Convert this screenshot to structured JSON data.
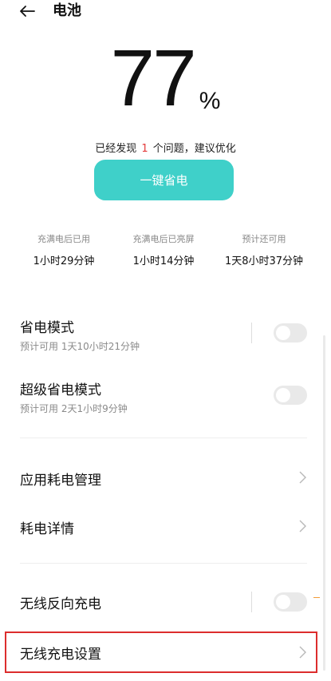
{
  "header": {
    "title": "电池",
    "back_icon": "arrow-left-icon"
  },
  "battery": {
    "percent": "77",
    "percent_sign": "%",
    "issue_prefix": "已经发现",
    "issue_count": "1",
    "issue_suffix": "个问题，建议优化",
    "optimize_label": "一键省电"
  },
  "stats": [
    {
      "label": "充满电后已用",
      "value": "1小时29分钟"
    },
    {
      "label": "充满电后已亮屏",
      "value": "1小时14分钟"
    },
    {
      "label": "预计还可用",
      "value": "1天8小时37分钟"
    }
  ],
  "rows": {
    "power_saving": {
      "title": "省电模式",
      "subtitle": "预计可用 1天10小时21分钟",
      "enabled": false
    },
    "super_power_saving": {
      "title": "超级省电模式",
      "subtitle": "预计可用 2天1小时9分钟",
      "enabled": false
    },
    "app_power_management": {
      "title": "应用耗电管理"
    },
    "power_details": {
      "title": "耗电详情"
    },
    "wireless_reverse_charging": {
      "title": "无线反向充电",
      "enabled": false
    },
    "wireless_charging_settings": {
      "title": "无线充电设置"
    }
  },
  "colors": {
    "accent": "#3fd0c9",
    "issue_count": "#e33b3b",
    "highlight": "#dc2d2d"
  }
}
